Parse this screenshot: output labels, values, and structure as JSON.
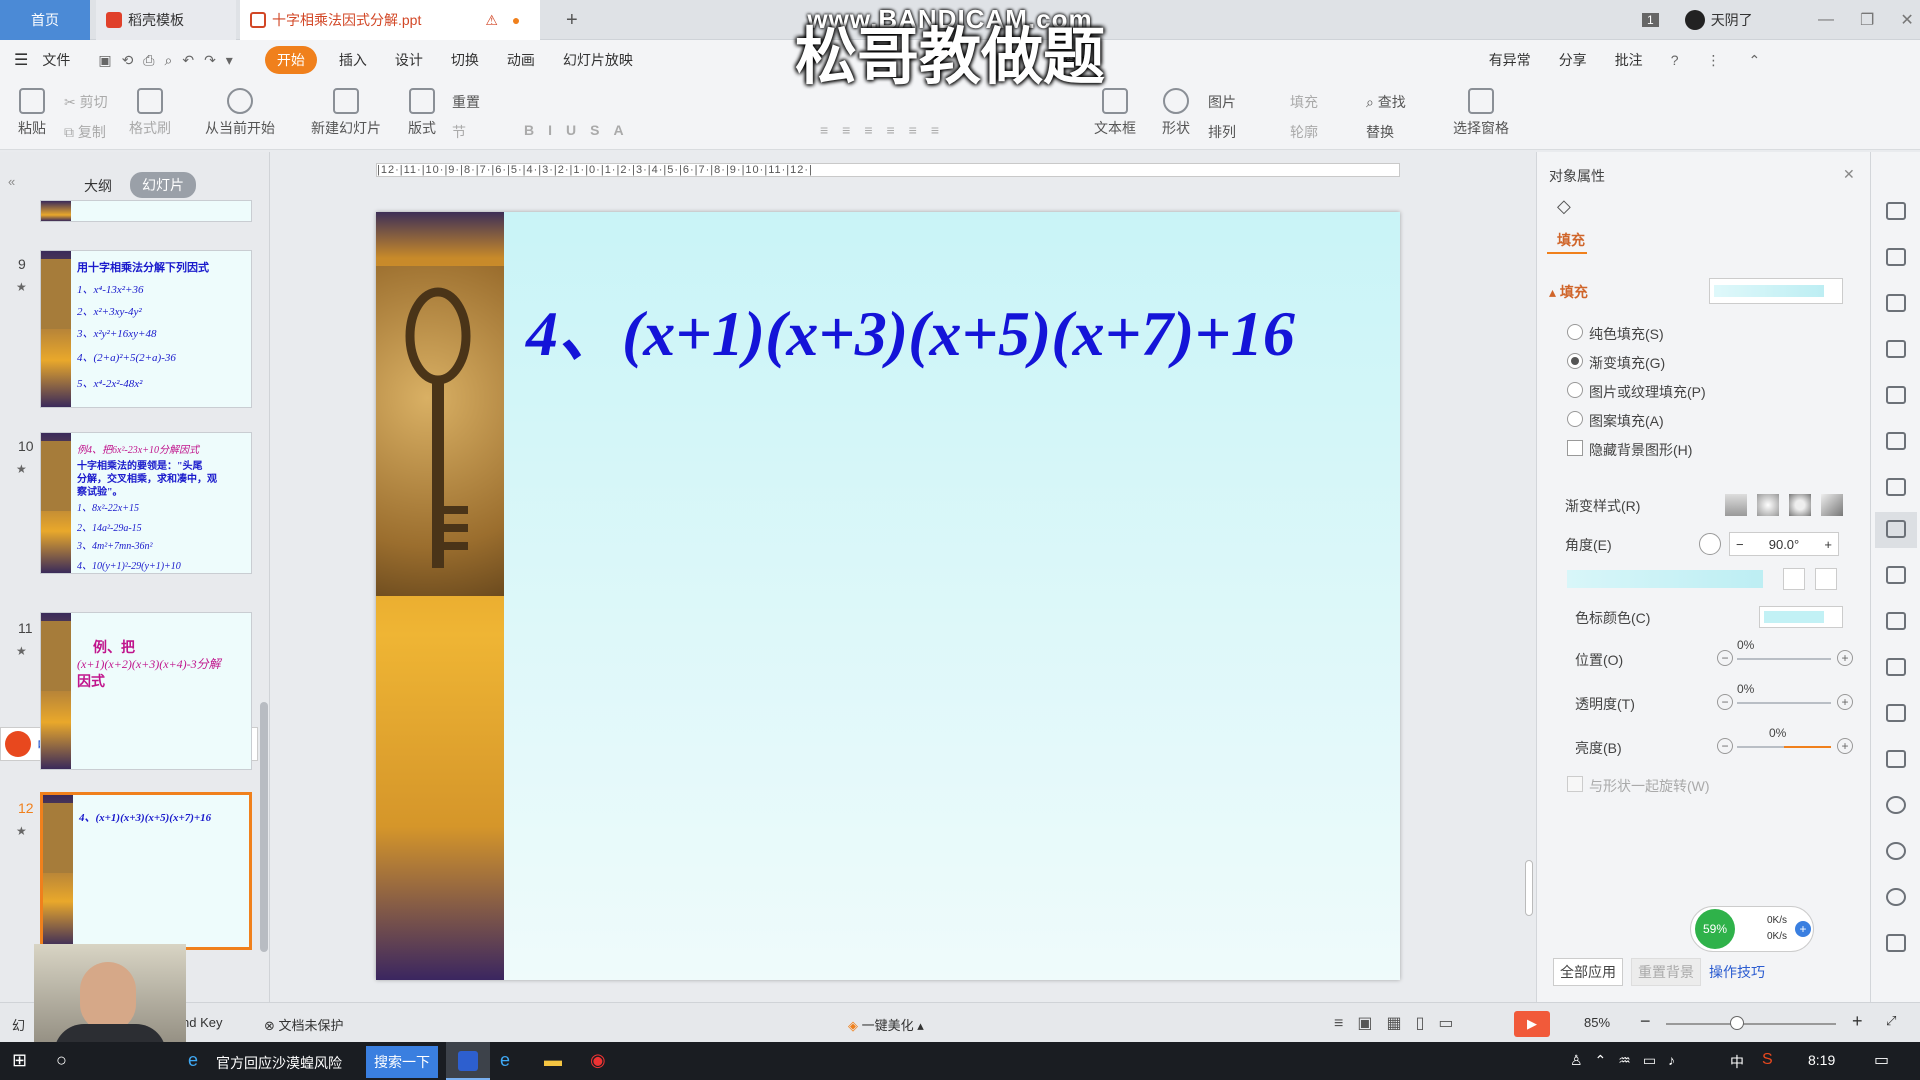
{
  "tabs": {
    "home": "首页",
    "template": "稻壳模板",
    "doc": "十字相乘法因式分解.ppt",
    "new_tab": "+"
  },
  "titlebar_right": {
    "badge": "1",
    "user": "天阴了"
  },
  "menu": [
    "文件",
    "开始",
    "插入",
    "设计",
    "切换",
    "动画",
    "幻灯片放映"
  ],
  "menu_right": {
    "search": "查找",
    "status": "有异常",
    "share": "分享",
    "comment": "批注"
  },
  "ribbon": {
    "paste": "粘贴",
    "cut": "剪切",
    "copy": "复制",
    "format": "格式刷",
    "from_current": "从当前开始",
    "new_slide": "新建幻灯片",
    "layout": "版式",
    "section": "节",
    "reset": "重置",
    "font_size": "0",
    "text_box": "文本框",
    "shape": "形状",
    "picture": "图片",
    "fill": "填充",
    "arrange": "排列",
    "outline": "轮廓",
    "find": "查找",
    "replace": "替换",
    "select_pane": "选择窗格"
  },
  "watermark": {
    "url": "www.BANDICAM.com",
    "title": "松哥教做题"
  },
  "left_panel": {
    "tab_outline": "大纲",
    "tab_slides": "幻灯片",
    "slides": [
      {
        "num": "9",
        "lines": [
          "用十字相乘法分解下列因式",
          "1、x⁴-13x²+36",
          "2、x²+3xy-4y²",
          "3、x²y²+16xy+48",
          "4、(2+a)²+5(2+a)-36",
          "5、x⁴-2x²-48x²"
        ]
      },
      {
        "num": "10",
        "lines": [
          "例4、把6x²-23x+10分解因式",
          "十字相乘法的要领是：\"头尾",
          "分解，交叉相乘，求和凑中，观",
          "察试验\"。",
          "1、8x²-22x+15",
          "2、14a²-29a-15",
          "3、4m²+7mn-36n²",
          "4、10(y+1)²-29(y+1)+10"
        ]
      },
      {
        "num": "11",
        "lines": [
          "例、把",
          "(x+1)(x+2)(x+3)(x+4)-3分解",
          "因式"
        ]
      },
      {
        "num": "12",
        "lines": [
          "4、(x+1)(x+3)(x+5)(x+7)+16"
        ]
      }
    ]
  },
  "ime": {
    "lang": "中",
    "punct": "°,"
  },
  "ruler": "|12·|11·|10·|9·|8·|7·|6·|5·|4·|3·|2·|1·|0·|1·|2·|3·|4·|5·|6·|7·|8·|9·|10·|11·|12·|",
  "slide": {
    "title": "4、(x+1)(x+3)(x+5)(x+7)+16"
  },
  "right_panel": {
    "title": "对象属性",
    "tab": "填充",
    "section": "填充",
    "options": [
      "纯色填充(S)",
      "渐变填充(G)",
      "图片或纹理填充(P)",
      "图案填充(A)"
    ],
    "selected": 1,
    "hide_bg": "隐藏背景图形(H)",
    "gradient_style": "渐变样式(R)",
    "angle_label": "角度(E)",
    "angle_value": "90.0°",
    "stop_color": "色标颜色(C)",
    "position": "位置(O)",
    "position_val": "0%",
    "transparency": "透明度(T)",
    "transparency_val": "0%",
    "brightness": "亮度(B)",
    "brightness_val": "0%",
    "rotate_with": "与形状一起旋转(W)",
    "apply_all": "全部应用",
    "reset_bg": "重置背景",
    "tips": "操作技巧"
  },
  "net": {
    "pct": "59%",
    "up": "0K/s",
    "down": "0K/s"
  },
  "status": {
    "left": "幻",
    "key": "nd Key",
    "protect": "文档未保护",
    "beautify": "一键美化",
    "zoom": "85%"
  },
  "taskbar": {
    "ad": "官方回应沙漠蝗风险",
    "search_btn": "搜索一下",
    "lang": "中",
    "time": "8:19"
  },
  "colors": {
    "accent": "#f0801c",
    "title_blue": "#1414d8",
    "home_tab": "#4b8ad6"
  }
}
